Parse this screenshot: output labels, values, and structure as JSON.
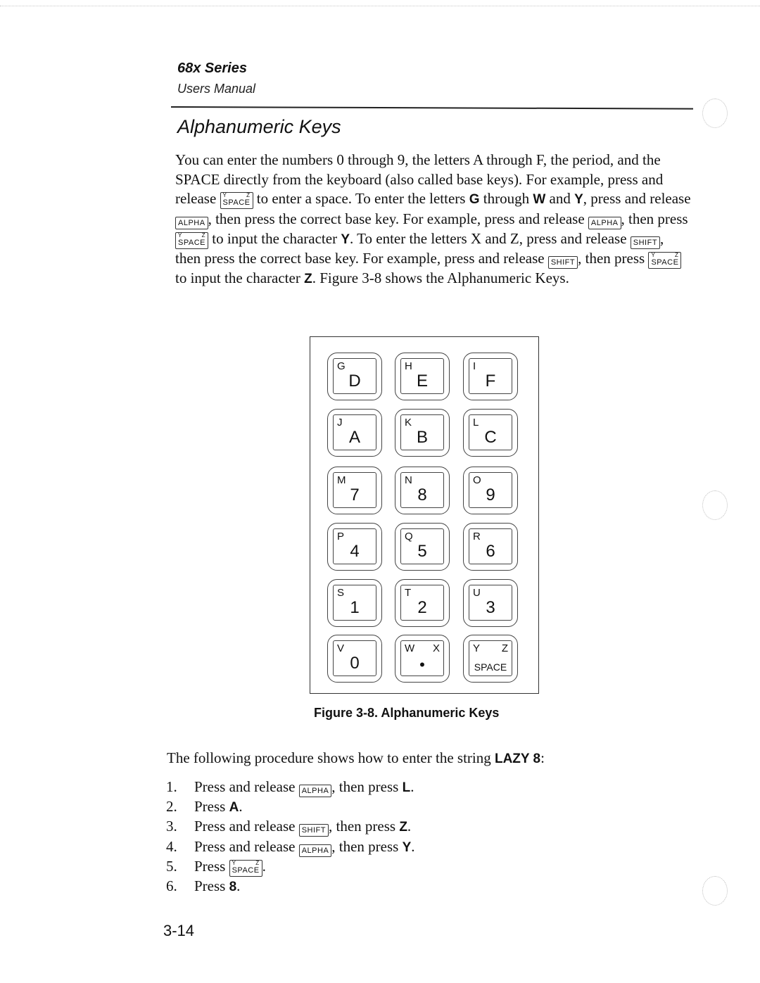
{
  "header": {
    "series": "68x Series",
    "manual": "Users Manual"
  },
  "section": {
    "title": "Alphanumeric Keys"
  },
  "keys_inline": {
    "space": {
      "label": "SPACE",
      "sup_left": "Y",
      "sup_right": "Z"
    },
    "alpha": {
      "label": "ALPHA"
    },
    "shift": {
      "label": "SHIFT"
    }
  },
  "intro": {
    "s1": "You can enter the numbers 0 through 9, the letters A through F, the period, and the SPACE directly from the keyboard (also called base keys). For example, press and release ",
    "s2": " to enter a space. To enter the letters ",
    "g": "G",
    "s3": " through ",
    "w": "W",
    "s4": " and ",
    "y": "Y",
    "s5": ", press and release ",
    "s6": ", then press the correct base key. For example, press and release ",
    "s7": ", then press ",
    "s8": " to input the character ",
    "y2": "Y",
    "s9": ". To enter the letters X and Z, press and release ",
    "s10": ", then press the correct base key. For example, press and release ",
    "s11": ", then press ",
    "s12": " to input the character ",
    "z": "Z",
    "s13": ". Figure 3-8 shows the Alphanumeric Keys."
  },
  "figure": {
    "caption": "Figure 3-8.  Alphanumeric Keys",
    "keys": [
      {
        "alt": "G",
        "main": "D"
      },
      {
        "alt": "H",
        "main": "E"
      },
      {
        "alt": "I",
        "main": "F"
      },
      {
        "alt": "J",
        "main": "A"
      },
      {
        "alt": "K",
        "main": "B"
      },
      {
        "alt": "L",
        "main": "C"
      },
      {
        "alt": "M",
        "main": "7"
      },
      {
        "alt": "N",
        "main": "8"
      },
      {
        "alt": "O",
        "main": "9"
      },
      {
        "alt": "P",
        "main": "4"
      },
      {
        "alt": "Q",
        "main": "5"
      },
      {
        "alt": "R",
        "main": "6"
      },
      {
        "alt": "S",
        "main": "1"
      },
      {
        "alt": "T",
        "main": "2"
      },
      {
        "alt": "U",
        "main": "3"
      },
      {
        "alt": "V",
        "main": "0"
      },
      {
        "alt": "W",
        "alt_right": "X",
        "main": "•"
      },
      {
        "alt": "Y",
        "alt_right": "Z",
        "main": "SPACE"
      }
    ]
  },
  "procedure": {
    "lead": "The following procedure shows how to enter the string ",
    "target": "LAZY 8",
    "lead_end": ":",
    "steps": [
      {
        "num": "1.",
        "pre": "Press and release ",
        "key": "ALPHA",
        "post": ", then press ",
        "char": "L",
        "end": "."
      },
      {
        "num": "2.",
        "pre": "Press ",
        "char": "A",
        "end": "."
      },
      {
        "num": "3.",
        "pre": "Press and release ",
        "key": "SHIFT",
        "post": ", then press ",
        "char": "Z",
        "end": "."
      },
      {
        "num": "4.",
        "pre": "Press and release ",
        "key": "ALPHA",
        "post": ", then press ",
        "char": "Y",
        "end": "."
      },
      {
        "num": "5.",
        "pre": "Press ",
        "key": "SPACE",
        "end": "."
      },
      {
        "num": "6.",
        "pre": "Press ",
        "char": "8",
        "end": "."
      }
    ]
  },
  "footer": {
    "page_number": "3-14"
  }
}
